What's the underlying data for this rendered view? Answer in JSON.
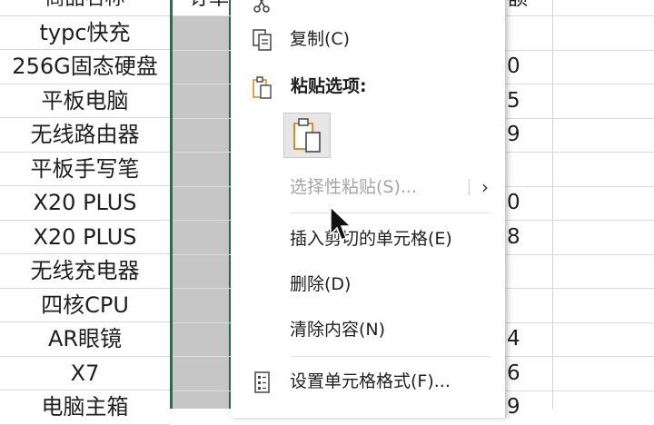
{
  "sheet": {
    "col_a_header": "商品名称",
    "col_b_header": "订单",
    "col_d_header": "额",
    "products": [
      "typc快充",
      "256G固态硬盘",
      "平板电脑",
      "无线路由器",
      "平板手写笔",
      "X20 PLUS",
      "X20 PLUS",
      "无线充电器",
      "四核CPU",
      "AR眼镜",
      "X7",
      "电脑主箱"
    ],
    "col_d_values": [
      "",
      "",
      "0",
      "5",
      "9",
      "",
      "0",
      "8",
      "",
      "",
      "4",
      "6",
      "9"
    ]
  },
  "menu": {
    "copy_label": "复制(C)",
    "paste_options_label": "粘贴选项:",
    "paste_special_label": "选择性粘贴(S)...",
    "insert_cut_cells_label": "插入剪切的单元格(E)",
    "delete_label": "删除(D)",
    "clear_contents_label": "清除内容(N)",
    "format_cells_label": "设置单元格格式(F)...",
    "submenu_arrow": "›"
  },
  "colors": {
    "selection_border": "#217346",
    "selected_fill": "#c6c6c6",
    "paste_icon_orange": "#d6902a"
  }
}
